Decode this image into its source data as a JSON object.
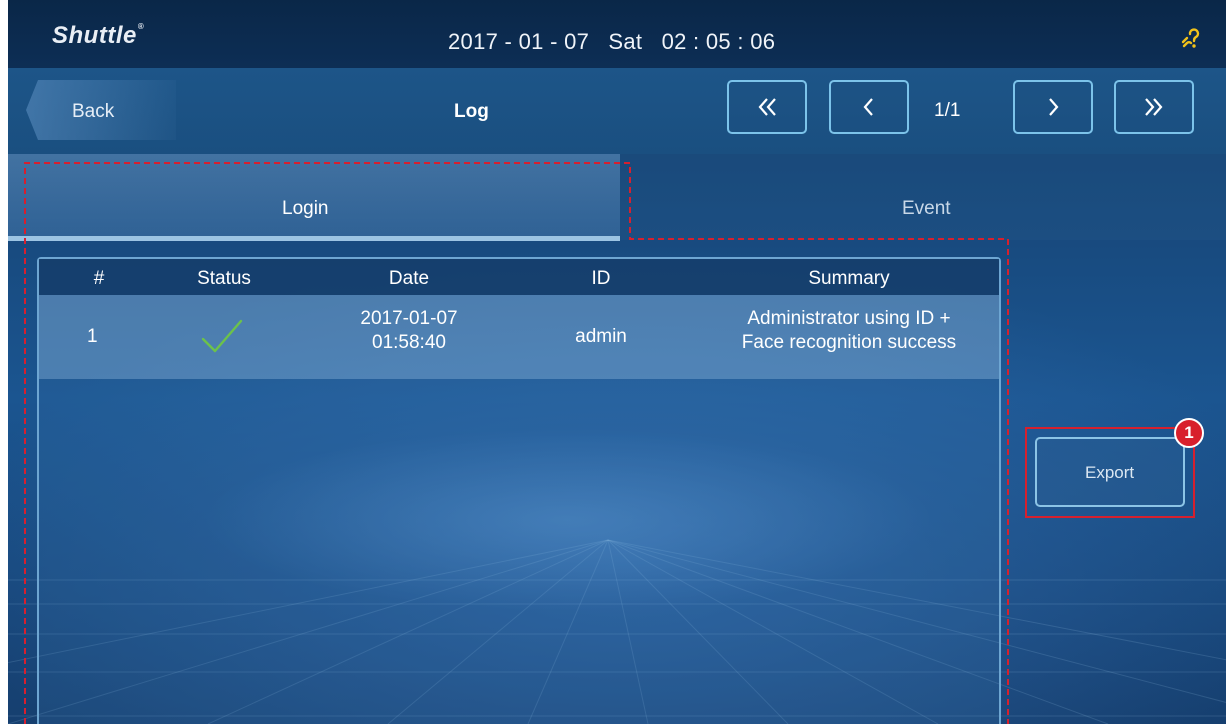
{
  "topbar": {
    "logo": "Shuttle",
    "logo_mark": "®",
    "datetime": "2017 - 01 - 07   Sat   02 : 05 : 06",
    "help_icon": "link-question-icon"
  },
  "navbar": {
    "back_label": "Back",
    "title": "Log",
    "page_indicator": "1/1",
    "buttons": {
      "first": "double-chevron-left-icon",
      "prev": "chevron-left-icon",
      "next": "chevron-right-icon",
      "last": "double-chevron-right-icon"
    }
  },
  "tabs": [
    {
      "label": "Login",
      "active": true
    },
    {
      "label": "Event",
      "active": false
    }
  ],
  "table": {
    "columns": [
      "#",
      "Status",
      "Date",
      "ID",
      "Summary"
    ],
    "rows": [
      {
        "index": "1",
        "status_icon": "check-icon",
        "date_line1": "2017-01-07",
        "date_line2": "01:58:40",
        "id": "admin",
        "summary_line1": "Administrator using ID +",
        "summary_line2": "Face recognition success"
      }
    ]
  },
  "export": {
    "label": "Export",
    "step_badge": "1"
  },
  "colors": {
    "accent_border": "#7cc3ea",
    "annotation_red": "#d6202e",
    "check_green": "#6cc24a"
  }
}
